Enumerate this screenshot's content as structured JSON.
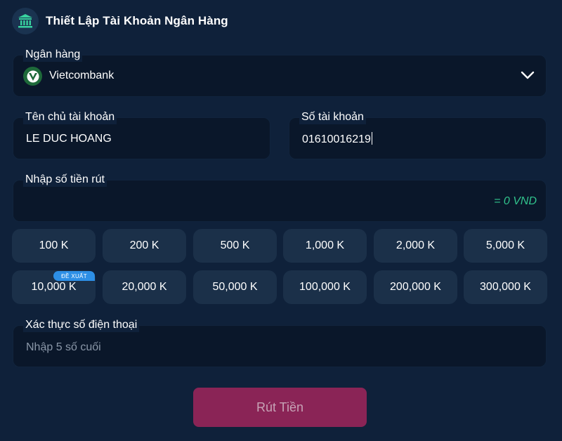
{
  "header": {
    "title": "Thiết Lập Tài Khoản Ngân Hàng",
    "icon": "bank-icon"
  },
  "bank": {
    "label": "Ngân hàng",
    "selected": "Vietcombank",
    "logo_icon": "vietcombank-logo-icon"
  },
  "account_name": {
    "label": "Tên chủ tài khoản",
    "value": "LE DUC HOANG"
  },
  "account_number": {
    "label": "Số tài khoản",
    "value": "01610016219"
  },
  "amount": {
    "label": "Nhập số tiền rút",
    "value": "",
    "converted": "= 0 VND"
  },
  "presets": [
    "100 K",
    "200 K",
    "500 K",
    "1,000 K",
    "2,000 K",
    "5,000 K",
    "10,000 K",
    "20,000 K",
    "50,000 K",
    "100,000 K",
    "200,000 K",
    "300,000 K"
  ],
  "recommended_badge": "ĐỀ XUẤT",
  "phone_verify": {
    "label": "Xác thực số điện thoại",
    "placeholder": "Nhập 5 số cuối"
  },
  "submit_label": "Rút Tiền",
  "colors": {
    "background": "#0f213a",
    "field": "#0a172a",
    "chip": "#1b3049",
    "accent_green": "#31c48d",
    "submit": "#8a2456",
    "badge": "#2d8fe6"
  }
}
